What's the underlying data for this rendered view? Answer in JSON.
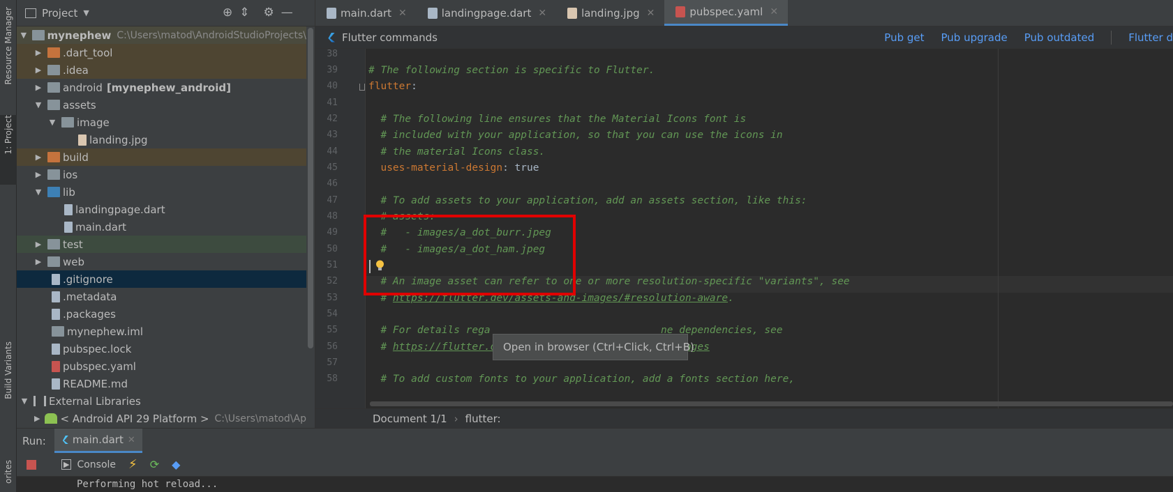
{
  "left_strip": {
    "resource_manager": "Resource Manager",
    "project_tab": "1: Project",
    "build_variants": "Build Variants",
    "favorites": "orites"
  },
  "project": {
    "title": "Project",
    "tree": [
      {
        "label": "mynephew",
        "path": "C:\\Users\\matod\\AndroidStudioProjects\\"
      },
      {
        "label": ".dart_tool"
      },
      {
        "label": ".idea"
      },
      {
        "label": "android",
        "bold_suffix": "[mynephew_android]"
      },
      {
        "label": "assets"
      },
      {
        "label": "image"
      },
      {
        "label": "landing.jpg"
      },
      {
        "label": "build"
      },
      {
        "label": "ios"
      },
      {
        "label": "lib"
      },
      {
        "label": "landingpage.dart"
      },
      {
        "label": "main.dart"
      },
      {
        "label": "test"
      },
      {
        "label": "web"
      },
      {
        "label": ".gitignore"
      },
      {
        "label": ".metadata"
      },
      {
        "label": ".packages"
      },
      {
        "label": "mynephew.iml"
      },
      {
        "label": "pubspec.lock"
      },
      {
        "label": "pubspec.yaml"
      },
      {
        "label": "README.md"
      },
      {
        "label": "External Libraries"
      },
      {
        "label": "< Android API 29 Platform >",
        "path": "C:\\Users\\matod\\Ap"
      }
    ]
  },
  "tabs": [
    {
      "label": "main.dart"
    },
    {
      "label": "landingpage.dart"
    },
    {
      "label": "landing.jpg"
    },
    {
      "label": "pubspec.yaml"
    }
  ],
  "flutter_bar": {
    "title": "Flutter commands",
    "pub_get": "Pub get",
    "pub_upgrade": "Pub upgrade",
    "pub_outdated": "Pub outdated",
    "flutter_doctor": "Flutter d"
  },
  "code": {
    "line_numbers": [
      "38",
      "39",
      "40",
      "41",
      "42",
      "43",
      "44",
      "45",
      "46",
      "47",
      "48",
      "49",
      "50",
      "51",
      "52",
      "53",
      "54",
      "55",
      "56",
      "57",
      "58"
    ],
    "l39": "# The following section is specific to Flutter.",
    "l40_key": "flutter",
    "l40_colon": ":",
    "l42": "  # The following line ensures that the Material Icons font is",
    "l43": "  # included with your application, so that you can use the icons in",
    "l44": "  # the material Icons class.",
    "l45_key": "  uses-material-design",
    "l45_val": ": true",
    "l47": "  # To add assets to your application, add an assets section, like this:",
    "l48": "  # assets:",
    "l49": "  #   - images/a_dot_burr.jpeg",
    "l50": "  #   - images/a_dot_ham.jpeg",
    "l52": "  # An image asset can refer to one or more resolution-specific \"variants\", see",
    "l53_prefix": "  # ",
    "l53_link": "https://flutter.dev/assets-and-images/#resolution-aware",
    "l53_suffix": ".",
    "l55": "  # For details rega                            ne dependencies, see",
    "l56_prefix": "  # ",
    "l56_link": "https://flutter.dev/assets-and-images/#from-packages",
    "l58": "  # To add custom fonts to your application, add a fonts section here,"
  },
  "tooltip": "Open in browser (Ctrl+Click, Ctrl+B)",
  "breadcrumb": {
    "doc": "Document 1/1",
    "node": "flutter:"
  },
  "run": {
    "label": "Run:",
    "tab": "main.dart",
    "console": "Console",
    "output": "Performing hot reload..."
  },
  "colors": {
    "accent": "#4a88c7",
    "link": "#589df6",
    "comment": "#629755",
    "key": "#cc7832",
    "highlight_box": "#e00000"
  }
}
